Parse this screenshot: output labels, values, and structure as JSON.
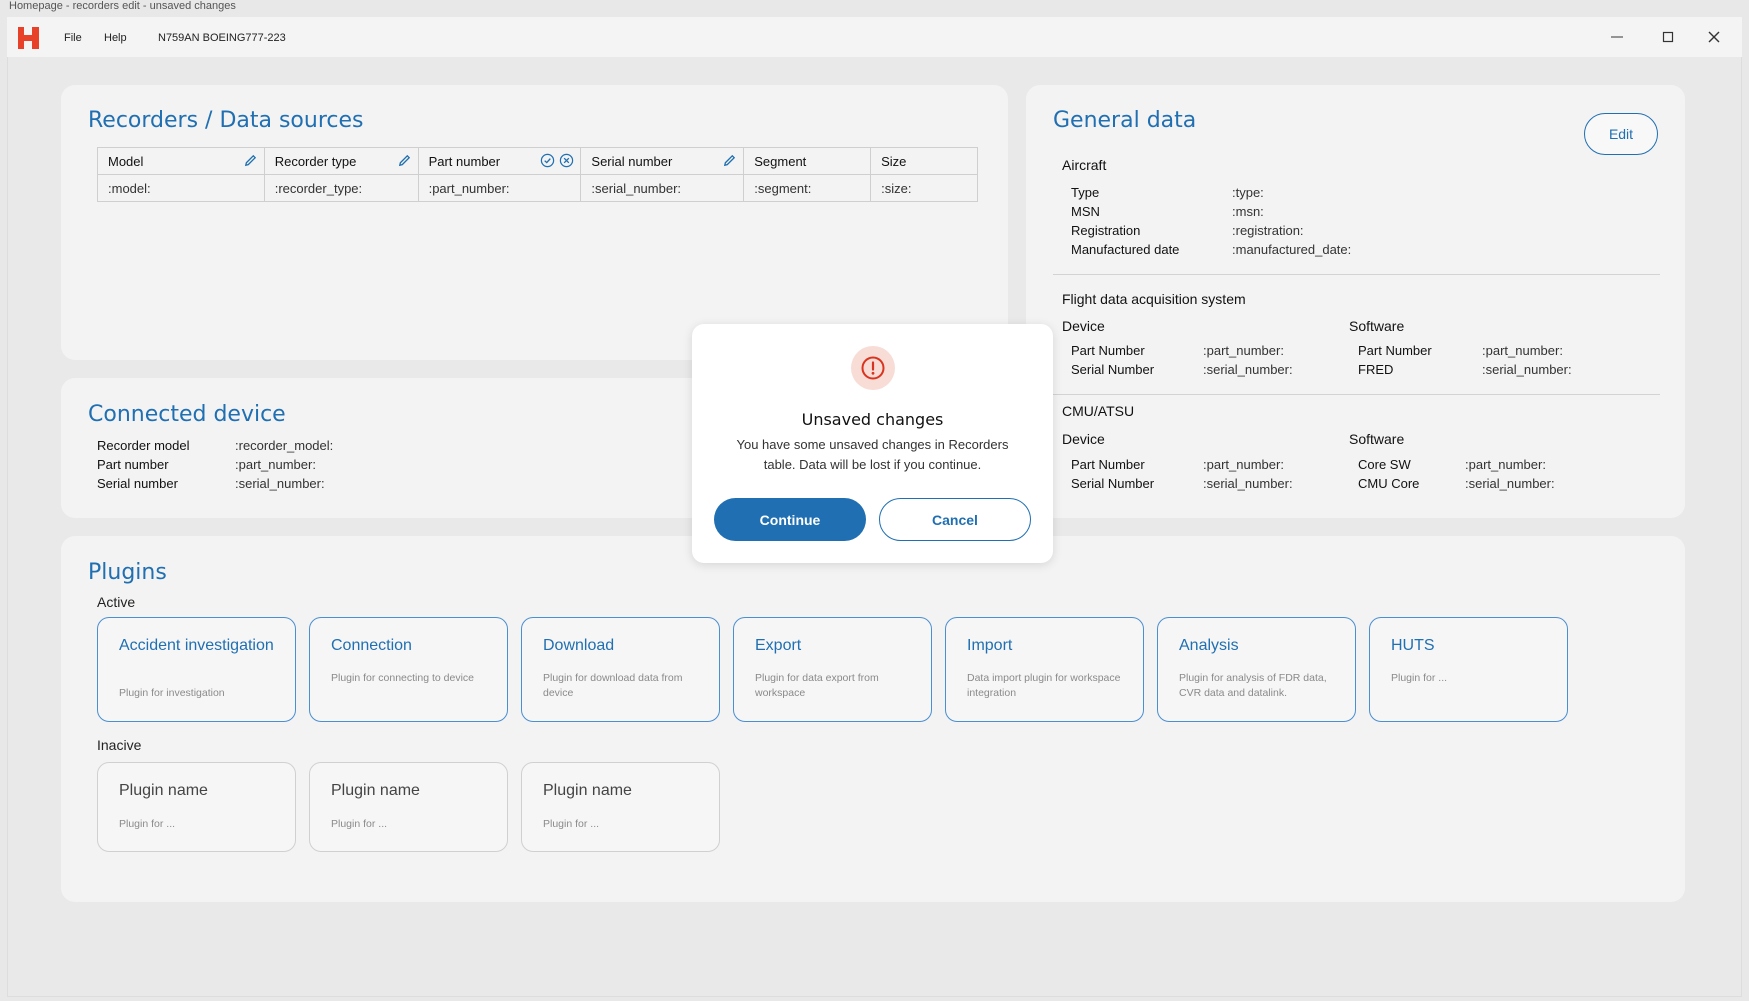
{
  "window": {
    "caption": "Homepage - recorders edit - unsaved changes",
    "menu": [
      "File",
      "Help"
    ],
    "aircraft_id": "N759AN BOEING777-223",
    "brand_color": "#e8412a"
  },
  "recorders": {
    "title": "Recorders / Data sources",
    "columns": [
      "Model",
      "Recorder type",
      "Part number",
      "Serial number",
      "Segment",
      "Size"
    ],
    "row": [
      ":model:",
      ":recorder_type:",
      ":part_number:",
      ":serial_number:",
      ":segment:",
      ":size:"
    ]
  },
  "connected_device": {
    "title": "Connected device",
    "fields": [
      {
        "label": "Recorder model",
        "value": ":recorder_model:"
      },
      {
        "label": "Part number",
        "value": ":part_number:"
      },
      {
        "label": "Serial number",
        "value": ":serial_number:"
      }
    ]
  },
  "general_data": {
    "title": "General data",
    "edit_label": "Edit",
    "aircraft": {
      "heading": "Aircraft",
      "fields": [
        {
          "label": "Type",
          "value": ":type:"
        },
        {
          "label": "MSN",
          "value": ":msn:"
        },
        {
          "label": "Registration",
          "value": ":registration:"
        },
        {
          "label": "Manufactured date",
          "value": ":manufactured_date:"
        }
      ]
    },
    "fdas": {
      "heading": "Flight data acquisition system",
      "device_heading": "Device",
      "software_heading": "Software",
      "device": [
        {
          "label": "Part Number",
          "value": ":part_number:"
        },
        {
          "label": "Serial Number",
          "value": ":serial_number:"
        }
      ],
      "software": [
        {
          "label": "Part Number",
          "value": ":part_number:"
        },
        {
          "label": "FRED",
          "value": ":serial_number:"
        }
      ]
    },
    "cmu": {
      "heading": "CMU/ATSU",
      "device_heading": "Device",
      "software_heading": "Software",
      "device": [
        {
          "label": "Part Number",
          "value": ":part_number:"
        },
        {
          "label": "Serial Number",
          "value": ":serial_number:"
        }
      ],
      "software": [
        {
          "label": "Core SW",
          "value": ":part_number:"
        },
        {
          "label": "CMU Core",
          "value": ":serial_number:"
        }
      ]
    }
  },
  "plugins": {
    "title": "Plugins",
    "active_label": "Active",
    "inactive_label": "Inacive",
    "active": [
      {
        "name": "Accident investigation",
        "desc": "Plugin for investigation"
      },
      {
        "name": "Connection",
        "desc": "Plugin for connecting to device"
      },
      {
        "name": "Download",
        "desc": "Plugin for download data from device"
      },
      {
        "name": "Export",
        "desc": "Plugin for data export from workspace"
      },
      {
        "name": "Import",
        "desc": "Data import plugin for workspace integration"
      },
      {
        "name": "Analysis",
        "desc": "Plugin for analysis of FDR data, CVR data and datalink."
      },
      {
        "name": "HUTS",
        "desc": "Plugin for ..."
      }
    ],
    "inactive": [
      {
        "name": "Plugin name",
        "desc": "Plugin for ..."
      },
      {
        "name": "Plugin name",
        "desc": "Plugin for ..."
      },
      {
        "name": "Plugin name",
        "desc": "Plugin for ..."
      }
    ]
  },
  "modal": {
    "icon": "alert-circle-icon",
    "title": "Unsaved changes",
    "message": "You have some unsaved changes in Recorders table. Data will be lost if you continue.",
    "continue_label": "Continue",
    "cancel_label": "Cancel"
  }
}
